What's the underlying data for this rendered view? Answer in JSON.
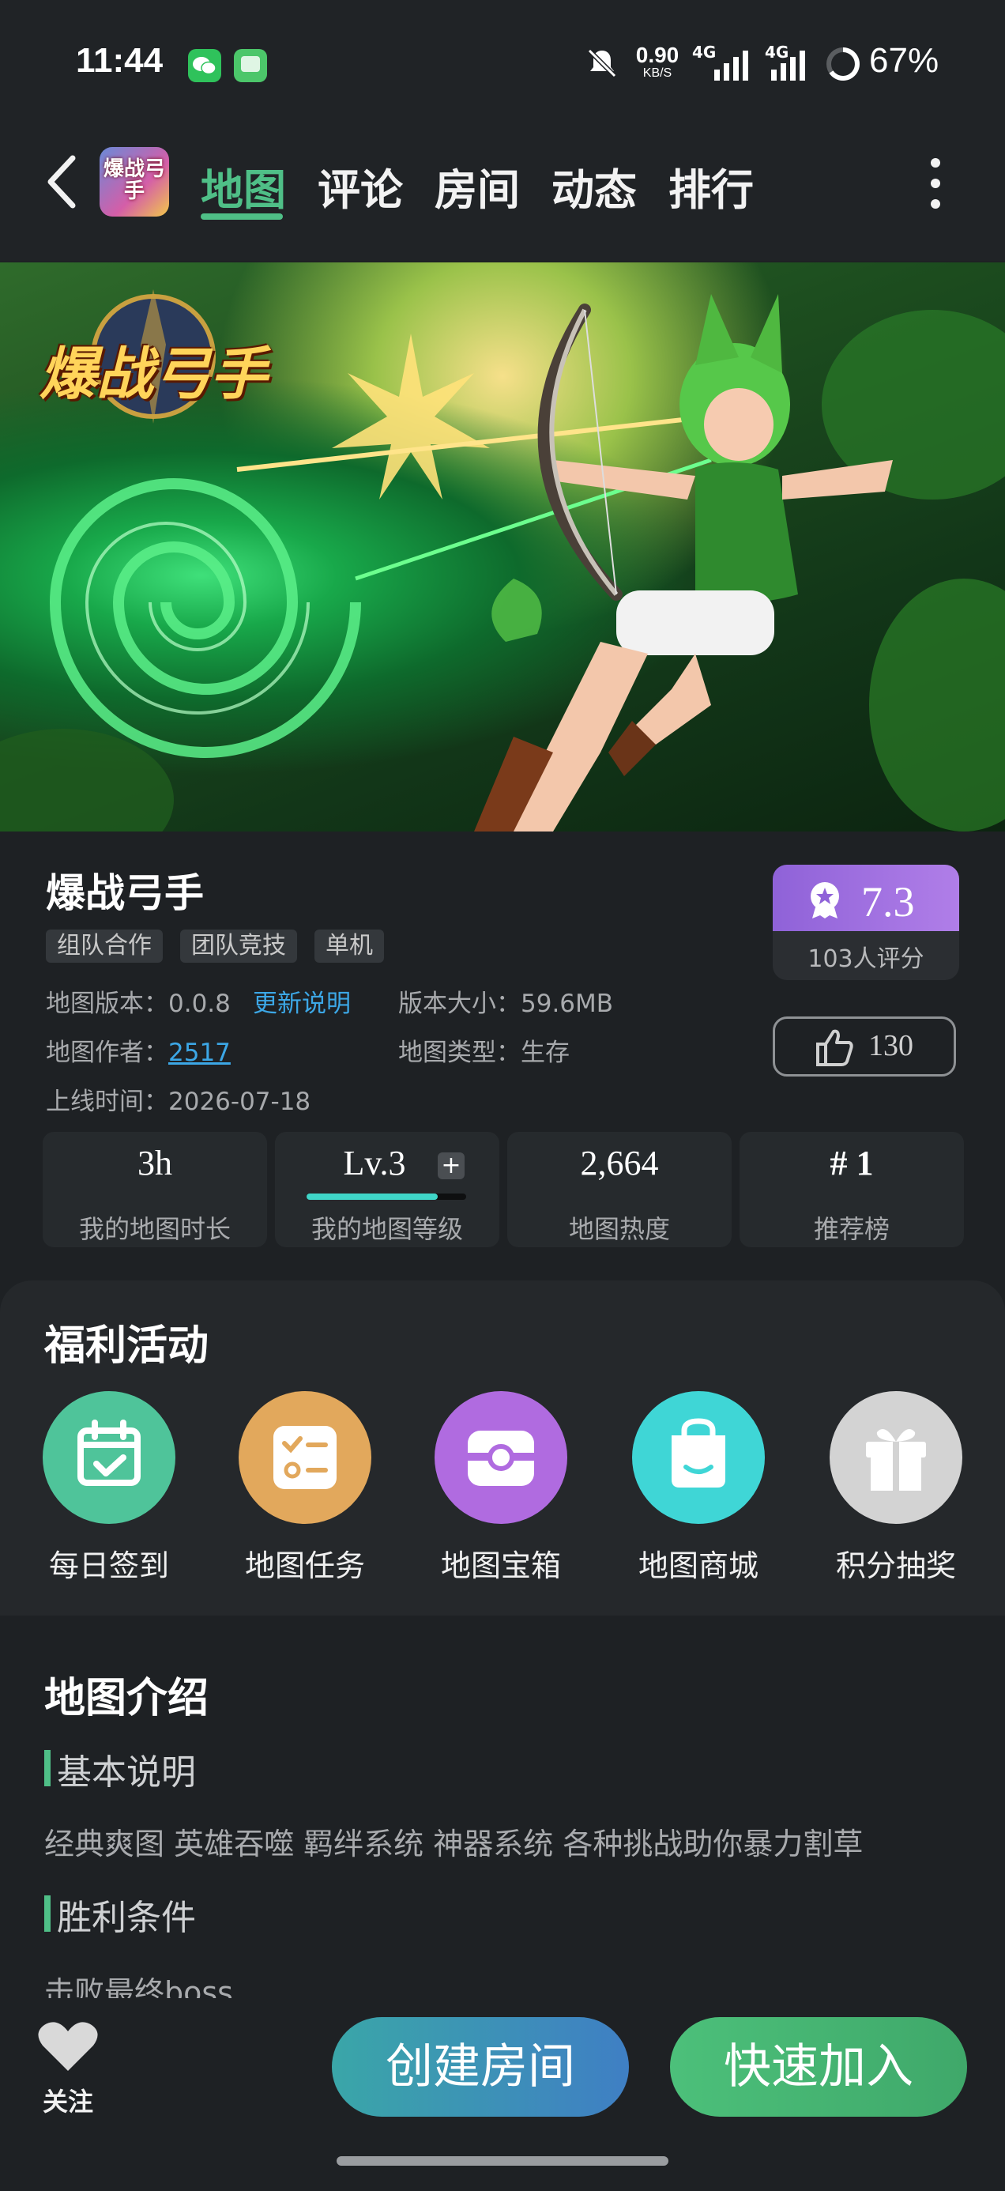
{
  "status_bar": {
    "time": "11:44",
    "speed_value": "0.90",
    "speed_unit": "KB/S",
    "net1": "4G",
    "net2": "4G",
    "battery": "67%"
  },
  "nav": {
    "tabs": [
      {
        "label": "地图",
        "active": true
      },
      {
        "label": "评论",
        "active": false
      },
      {
        "label": "房间",
        "active": false
      },
      {
        "label": "动态",
        "active": false
      },
      {
        "label": "排行",
        "active": false
      }
    ],
    "app_icon_text": "爆战弓手"
  },
  "banner": {
    "logo_text": "爆战弓手"
  },
  "map_info": {
    "title": "爆战弓手",
    "tags": [
      "组队合作",
      "团队竞技",
      "单机"
    ],
    "version_label": "地图版本：",
    "version_value": "0.0.8",
    "update_notes_link": "更新说明",
    "size_label": "版本大小：",
    "size_value": "59.6MB",
    "author_label": "地图作者：",
    "author_value": "2517",
    "type_label": "地图类型：",
    "type_value": "生存",
    "online_label": "上线时间：",
    "online_value": "2026-07-18",
    "score": "7.3",
    "score_count": "103人评分",
    "likes": "130"
  },
  "stats": [
    {
      "value": "3h",
      "label": "我的地图时长"
    },
    {
      "value": "Lv.3",
      "label": "我的地图等级",
      "progress": 0.82
    },
    {
      "value": "2,664",
      "label": "地图热度"
    },
    {
      "value": "# 1",
      "label": "推荐榜"
    }
  ],
  "welfare": {
    "title": "福利活动",
    "items": [
      {
        "label": "每日签到",
        "icon": "calendar-check-icon",
        "color": "#4fc49a"
      },
      {
        "label": "地图任务",
        "icon": "task-list-icon",
        "color": "#e2a85c"
      },
      {
        "label": "地图宝箱",
        "icon": "treasure-chest-icon",
        "color": "#b06be0"
      },
      {
        "label": "地图商城",
        "icon": "shopping-bag-icon",
        "color": "#3fd6d6"
      },
      {
        "label": "积分抽奖",
        "icon": "gift-icon",
        "color": "#d3d3d3"
      }
    ]
  },
  "intro": {
    "title": "地图介绍",
    "section1_title": "基本说明",
    "section1_text": "经典爽图 英雄吞噬 羁绊系统 神器系统 各种挑战助你暴力割草",
    "section2_title": "胜利条件",
    "section2_text": "击败最终boss"
  },
  "bottom": {
    "follow_label": "关注",
    "create_room": "创建房间",
    "quick_join": "快速加入"
  }
}
